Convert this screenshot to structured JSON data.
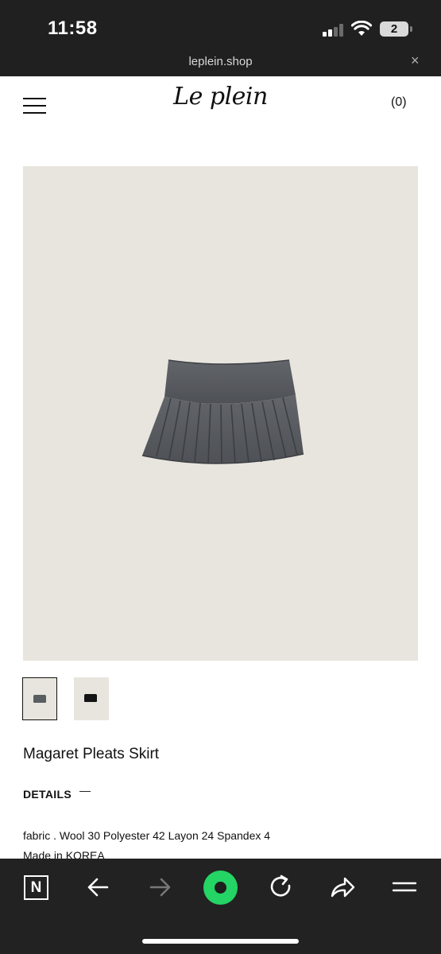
{
  "status_bar": {
    "time": "11:58",
    "battery_level": "2",
    "icons": [
      "cellular-signal-icon",
      "wifi-icon",
      "battery-icon"
    ]
  },
  "browser": {
    "url": "leplein.shop",
    "close_symbol": "×"
  },
  "site_header": {
    "menu_icon": "hamburger-menu-icon",
    "logo_text": "Le plein",
    "cart_label": "(0)"
  },
  "product": {
    "image_bg_color": "#e8e5de",
    "skirt_color": "#5a5d62",
    "thumbnail_colors": [
      "#5a5d62",
      "#141414"
    ],
    "name": "Magaret Pleats Skirt",
    "details_label": "DETAILS",
    "details_toggle": "—",
    "fabric": "fabric . Wool 30 Polyester 42 Layon 24 Spandex 4",
    "made_in": "Made in KOREA"
  },
  "toolbar": {
    "n_logo": "N",
    "icons": [
      "n-app-icon",
      "back-arrow-icon",
      "forward-arrow-icon",
      "record-icon",
      "reload-icon",
      "share-icon",
      "menu-icon"
    ],
    "accent_color": "#24d464"
  }
}
